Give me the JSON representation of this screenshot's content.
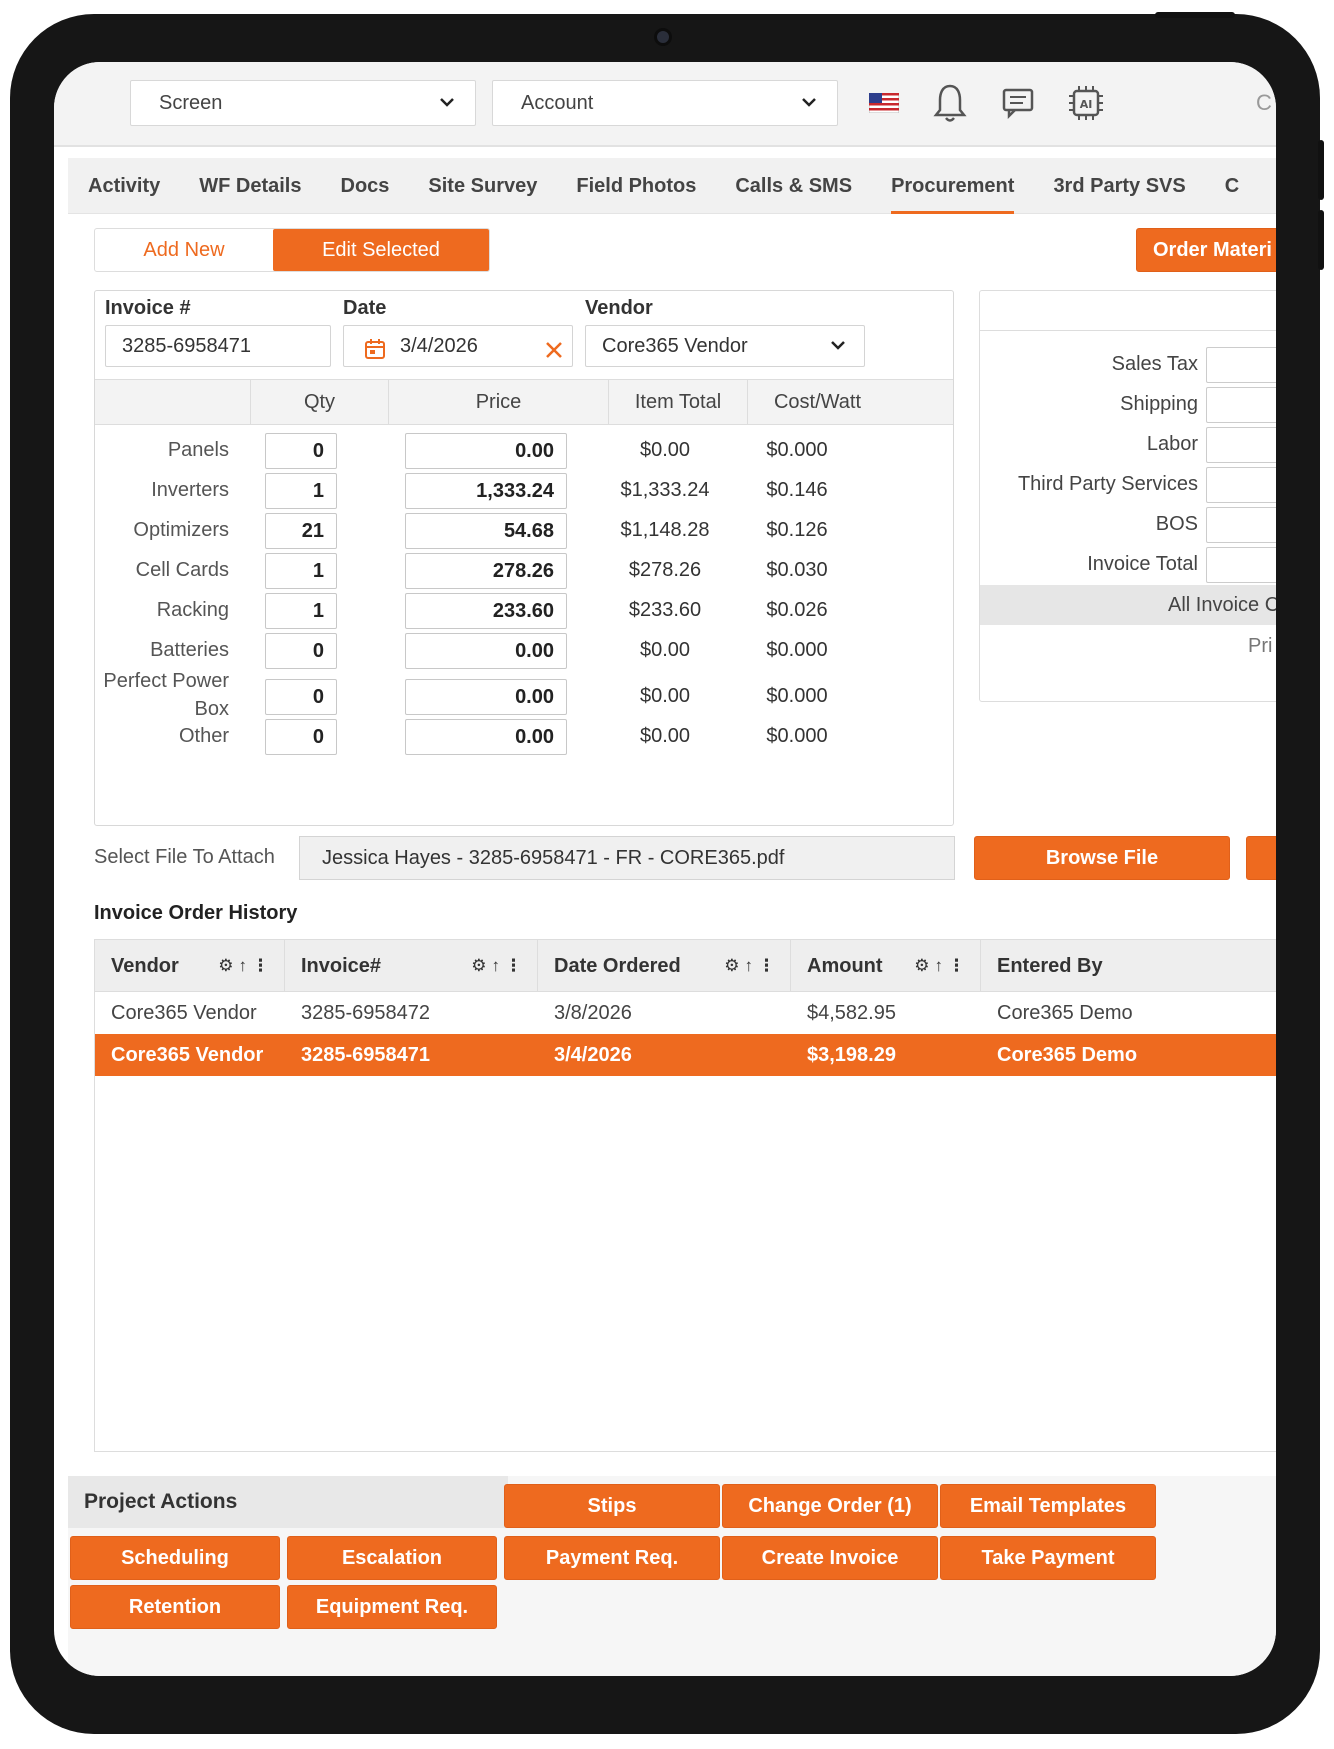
{
  "topbar": {
    "screen_select": "Screen",
    "account_select": "Account",
    "cut_text": "C"
  },
  "tabs": [
    {
      "label": "Activity"
    },
    {
      "label": "WF Details"
    },
    {
      "label": "Docs"
    },
    {
      "label": "Site Survey"
    },
    {
      "label": "Field Photos"
    },
    {
      "label": "Calls & SMS"
    },
    {
      "label": "Procurement",
      "active": true
    },
    {
      "label": "3rd Party SVS"
    },
    {
      "label": "C"
    }
  ],
  "mode": {
    "add_new": "Add New",
    "edit_selected": "Edit Selected"
  },
  "order_materials": "Order Materi",
  "invoice": {
    "invoice_label": "Invoice #",
    "invoice_value": "3285-6958471",
    "date_label": "Date",
    "date_value": "3/4/2026",
    "vendor_label": "Vendor",
    "vendor_value": "Core365 Vendor"
  },
  "grid": {
    "headers": {
      "qty": "Qty",
      "price": "Price",
      "item_total": "Item Total",
      "cost_watt": "Cost/Watt"
    },
    "rows": [
      {
        "label": "Panels",
        "qty": "0",
        "price": "0.00",
        "total": "$0.00",
        "cpw": "$0.000"
      },
      {
        "label": "Inverters",
        "qty": "1",
        "price": "1,333.24",
        "total": "$1,333.24",
        "cpw": "$0.146"
      },
      {
        "label": "Optimizers",
        "qty": "21",
        "price": "54.68",
        "total": "$1,148.28",
        "cpw": "$0.126"
      },
      {
        "label": "Cell Cards",
        "qty": "1",
        "price": "278.26",
        "total": "$278.26",
        "cpw": "$0.030"
      },
      {
        "label": "Racking",
        "qty": "1",
        "price": "233.60",
        "total": "$233.60",
        "cpw": "$0.026"
      },
      {
        "label": "Batteries",
        "qty": "0",
        "price": "0.00",
        "total": "$0.00",
        "cpw": "$0.000"
      },
      {
        "label": "Perfect Power",
        "label2": "Box",
        "qty": "0",
        "price": "0.00",
        "total": "$0.00",
        "cpw": "$0.000"
      },
      {
        "label": "Other",
        "qty": "0",
        "price": "0.00",
        "total": "$0.00",
        "cpw": "$0.000"
      }
    ]
  },
  "summary": {
    "labels": [
      "Sales Tax",
      "Shipping",
      "Labor",
      "Third Party Services",
      "BOS",
      "Invoice Total"
    ],
    "all_invoice": "All Invoice C",
    "pri": "Pri"
  },
  "attach": {
    "label": "Select File To Attach",
    "file": "Jessica Hayes - 3285-6958471 - FR - CORE365.pdf",
    "browse": "Browse File"
  },
  "history": {
    "title": "Invoice Order History",
    "columns": [
      "Vendor",
      "Invoice#",
      "Date Ordered",
      "Amount",
      "Entered By"
    ],
    "rows": [
      {
        "vendor": "Core365 Vendor",
        "invoice": "3285-6958472",
        "date": "3/8/2026",
        "amount": "$4,582.95",
        "entered_by": "Core365 Demo",
        "selected": false
      },
      {
        "vendor": "Core365 Vendor",
        "invoice": "3285-6958471",
        "date": "3/4/2026",
        "amount": "$3,198.29",
        "entered_by": "Core365 Demo",
        "selected": true
      }
    ]
  },
  "actions": {
    "title": "Project Actions",
    "buttons": [
      "Stips",
      "Change Order (1)",
      "Email Templates",
      "Scheduling",
      "Escalation",
      "Payment Req.",
      "Create Invoice",
      "Take Payment",
      "Retention",
      "Equipment Req."
    ]
  },
  "colors": {
    "accent": "#ee6a1f",
    "header_bg": "#f3f3f3",
    "device": "#161616"
  }
}
